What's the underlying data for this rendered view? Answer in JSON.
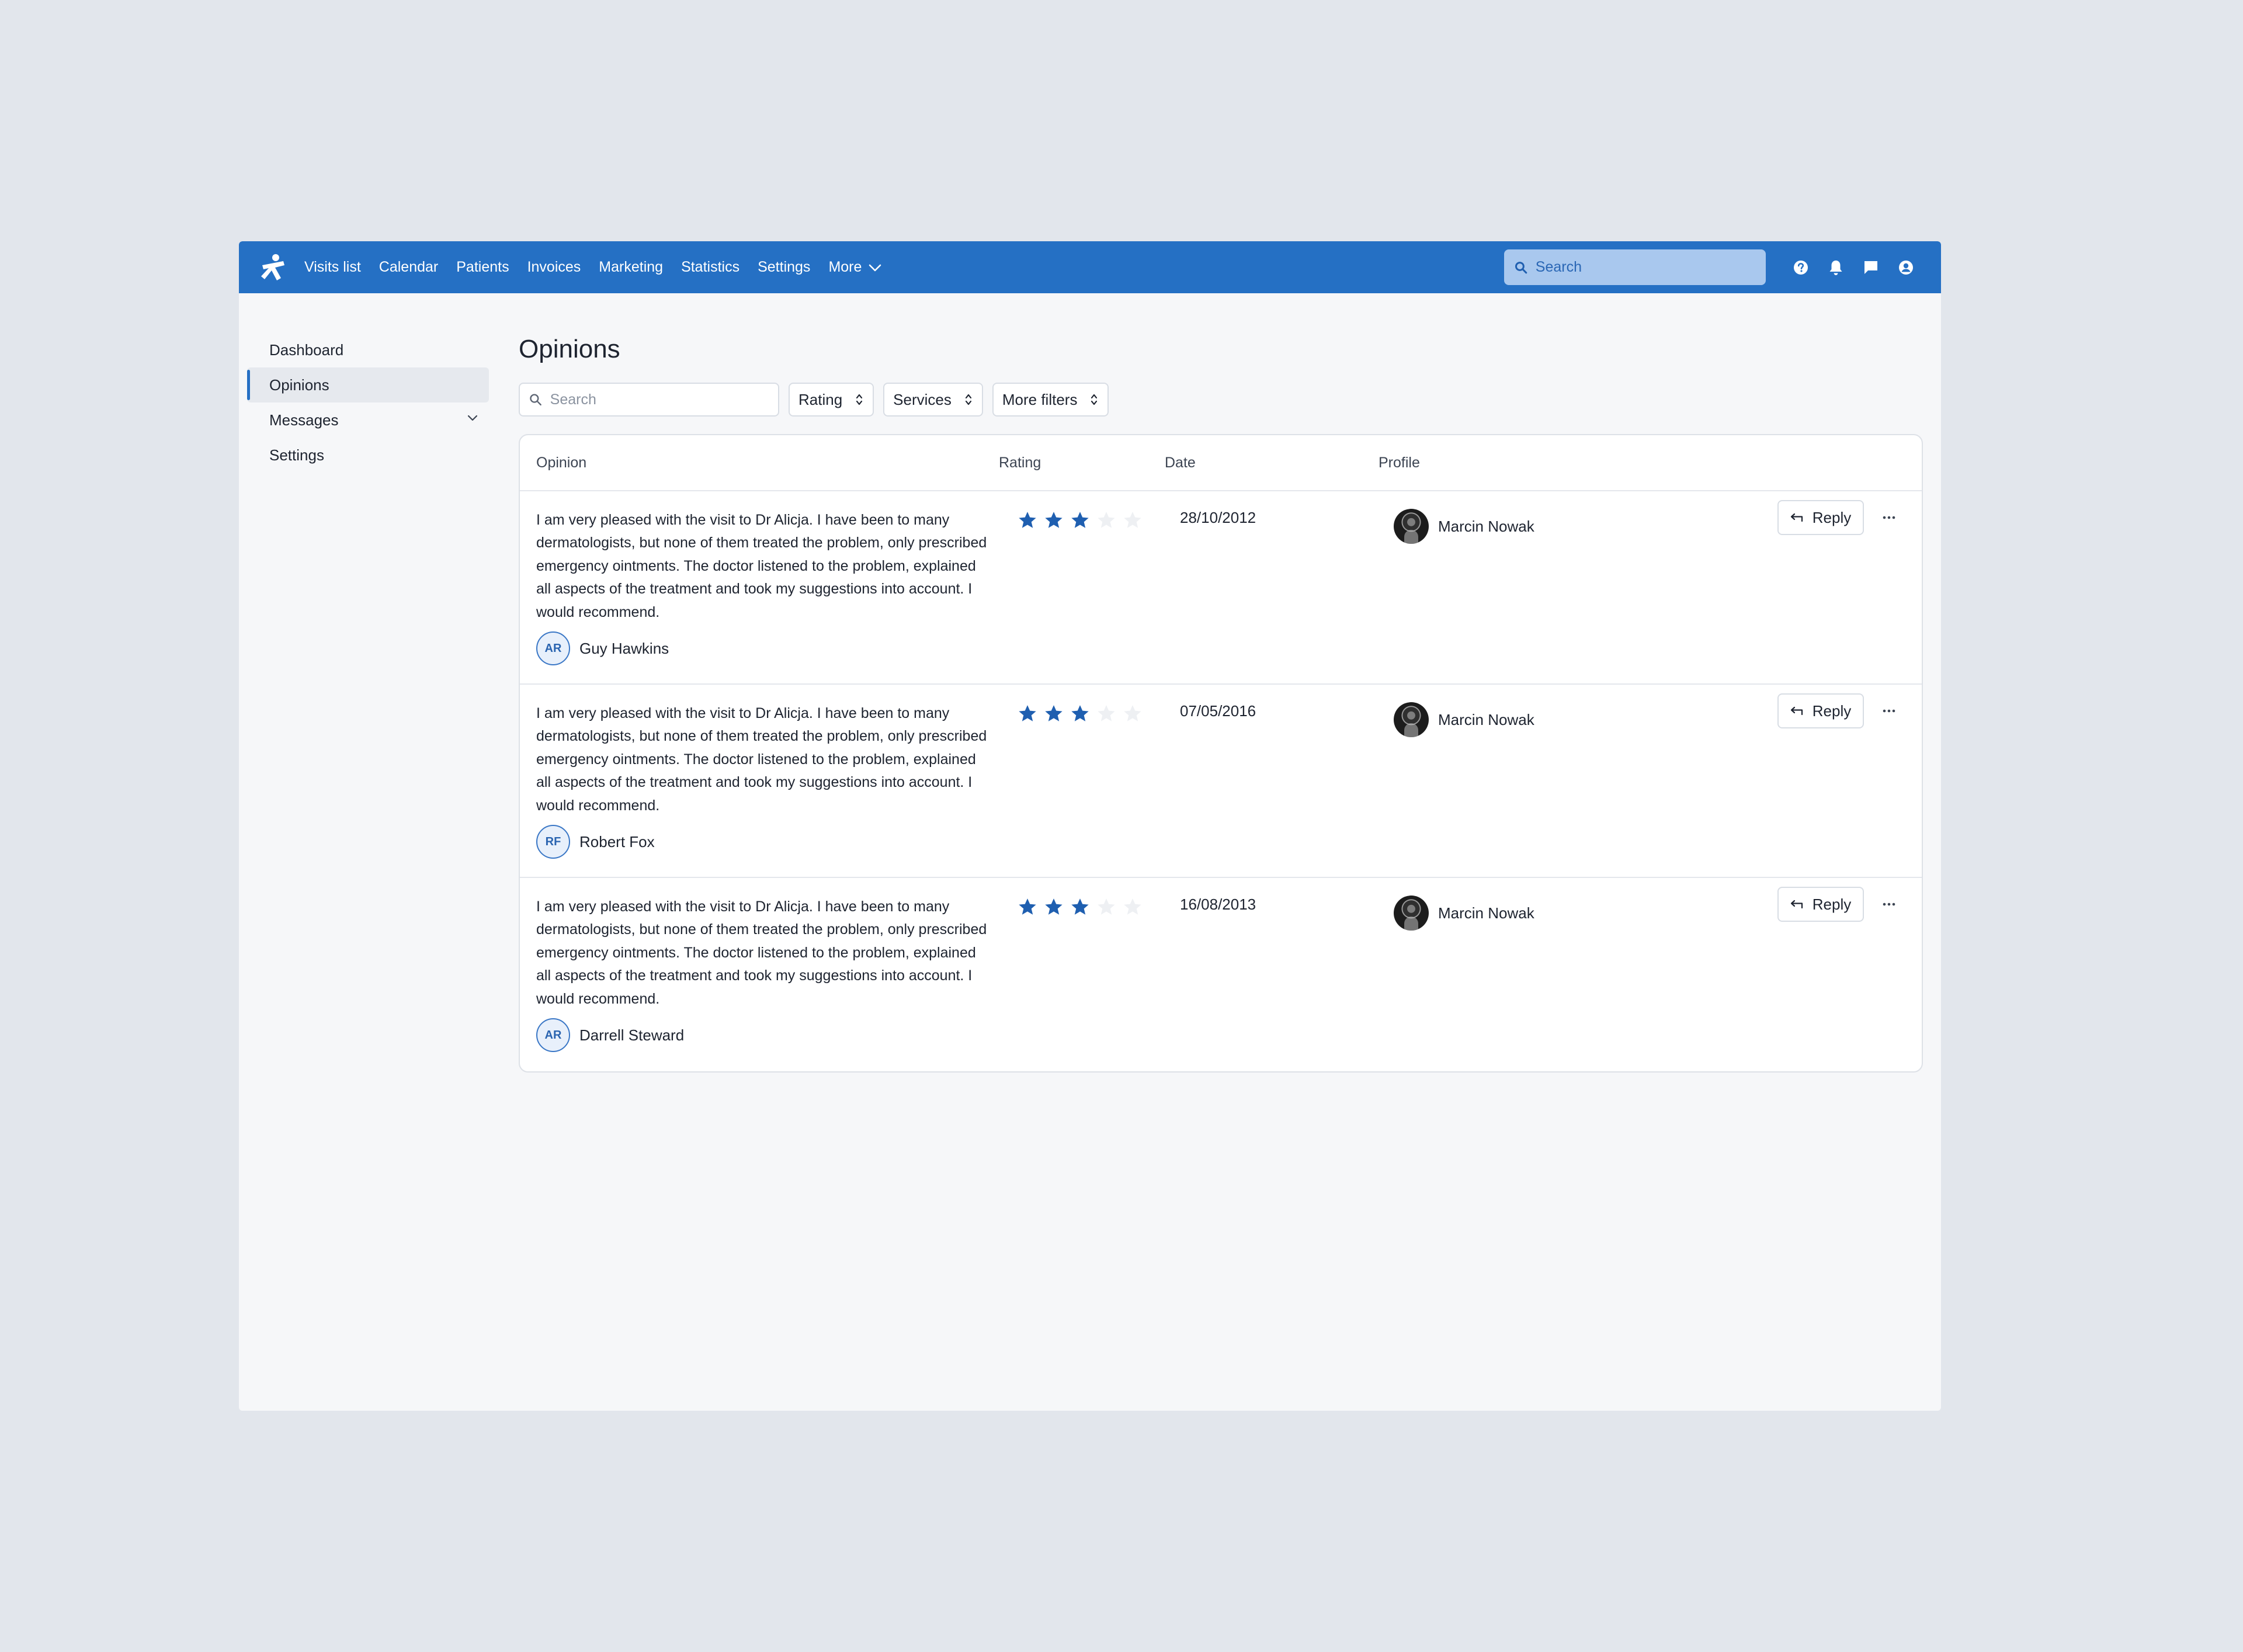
{
  "topbar": {
    "nav": [
      "Visits list",
      "Calendar",
      "Patients",
      "Invoices",
      "Marketing",
      "Statistics",
      "Settings"
    ],
    "more_label": "More",
    "search_placeholder": "Search",
    "icons": [
      "help-icon",
      "bell-icon",
      "chat-icon",
      "user-circle-icon"
    ]
  },
  "sidebar": {
    "items": [
      {
        "label": "Dashboard",
        "active": false
      },
      {
        "label": "Opinions",
        "active": true
      },
      {
        "label": "Messages",
        "active": false,
        "expandable": true
      },
      {
        "label": "Settings",
        "active": false
      }
    ]
  },
  "page": {
    "title": "Opinions",
    "filters": {
      "search_placeholder": "Search",
      "buttons": [
        "Rating",
        "Services",
        "More filters"
      ]
    }
  },
  "table": {
    "columns": [
      "Opinion",
      "Rating",
      "Date",
      "Profile"
    ],
    "reply_label": "Reply",
    "rows": [
      {
        "opinion": "I am very pleased with the visit to Dr Alicja. I have been to many dermatologists, but none of them treated the problem, only prescribed emergency ointments. The doctor listened to the problem, explained all aspects of the treatment and took my suggestions into account. I would recommend.",
        "author_initials": "AR",
        "author_name": "Guy Hawkins",
        "rating": 3,
        "rating_max": 5,
        "date": "28/10/2012",
        "profile_name": "Marcin Nowak"
      },
      {
        "opinion": "I am very pleased with the visit to Dr Alicja. I have been to many dermatologists, but none of them treated the problem, only prescribed emergency ointments. The doctor listened to the problem, explained all aspects of the treatment and took my suggestions into account. I would recommend.",
        "author_initials": "RF",
        "author_name": "Robert Fox",
        "rating": 3,
        "rating_max": 5,
        "date": "07/05/2016",
        "profile_name": "Marcin Nowak"
      },
      {
        "opinion": "I am very pleased with the visit to Dr Alicja. I have been to many dermatologists, but none of them treated the problem, only prescribed emergency ointments. The doctor listened to the problem, explained all aspects of the treatment and took my suggestions into account. I would recommend.",
        "author_initials": "AR",
        "author_name": "Darrell Steward",
        "rating": 3,
        "rating_max": 5,
        "date": "16/08/2013",
        "profile_name": "Marcin Nowak"
      }
    ]
  },
  "colors": {
    "brand": "#2570c4",
    "star_filled": "#1f5fb0",
    "star_empty": "#eef0f3",
    "background": "#f6f7f9"
  }
}
